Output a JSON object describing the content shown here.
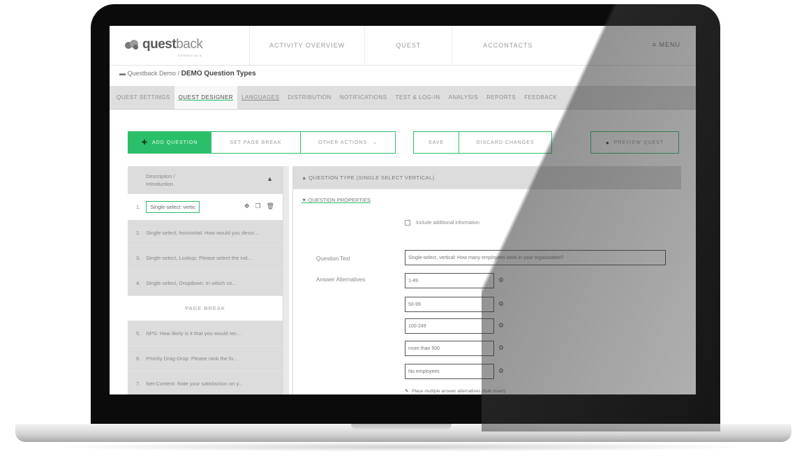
{
  "app": {
    "logo_text_bold": "quest",
    "logo_text_thin": "back",
    "logo_sub": "ESSENTIALS"
  },
  "topnav": {
    "links": [
      "ACTIVITY OVERVIEW",
      "QUEST",
      "ACCONTACTS"
    ],
    "menu": "≡ MENU"
  },
  "breadcrumb": {
    "parent": "Questback Demo",
    "separator": "/",
    "current": "DEMO Question Types"
  },
  "tabs": [
    "QUEST SETTINGS",
    "QUEST DESIGNER",
    "LANGUAGES",
    "DISTRIBUTION",
    "NOTIFICATIONS",
    "TEST & LOG-IN",
    "ANALYSIS",
    "REPORTS",
    "FEEDBACK"
  ],
  "actions": {
    "add_question": "ADD QUESTION",
    "set_page_break": "SET PAGE BREAK",
    "other_actions": "OTHER ACTIONS",
    "save": "SAVE",
    "discard_changes": "DISCARD CHANGES",
    "preview_quest": "PREVIEW QUEST"
  },
  "question_list": {
    "header": "Description / Introduction",
    "items": [
      {
        "num": "1.",
        "label": "Single-select: vertic"
      },
      {
        "num": "2.",
        "label": "Single-select, horizontal: How would you descr..."
      },
      {
        "num": "3.",
        "label": "Single-select, Lookup: Please select the ind..."
      },
      {
        "num": "4.",
        "label": "Single-select, Dropdown: In which co..."
      }
    ],
    "page_break": "PAGE BREAK",
    "items_after": [
      {
        "num": "5.",
        "label": "NPS: How likely is it that you would rec..."
      },
      {
        "num": "6.",
        "label": "Priority Drag-Drop: Please rank the fo..."
      },
      {
        "num": "7.",
        "label": "Net-Content: Rate your satisfaction on y..."
      }
    ]
  },
  "question_panel": {
    "type_header": "▲ QUESTION TYPE (SINGLE SELECT VERTICAL)",
    "properties_header": "▼ QUESTION PROPERTIES",
    "additional_info": "Include additional information",
    "question_text_label": "Question Text",
    "question_text_value": "Single-select, vertical: How many employees work in your organization?",
    "answer_alternatives_label": "Answer Alternatives",
    "alternatives": [
      "1-49",
      "50-99",
      "100-249",
      "more than 500",
      "No employees"
    ],
    "tip": "Place multiple answer alternatives (bulk insert)"
  },
  "colors": {
    "accent": "#2cbf6a",
    "bezel": "#0b0b0b"
  }
}
